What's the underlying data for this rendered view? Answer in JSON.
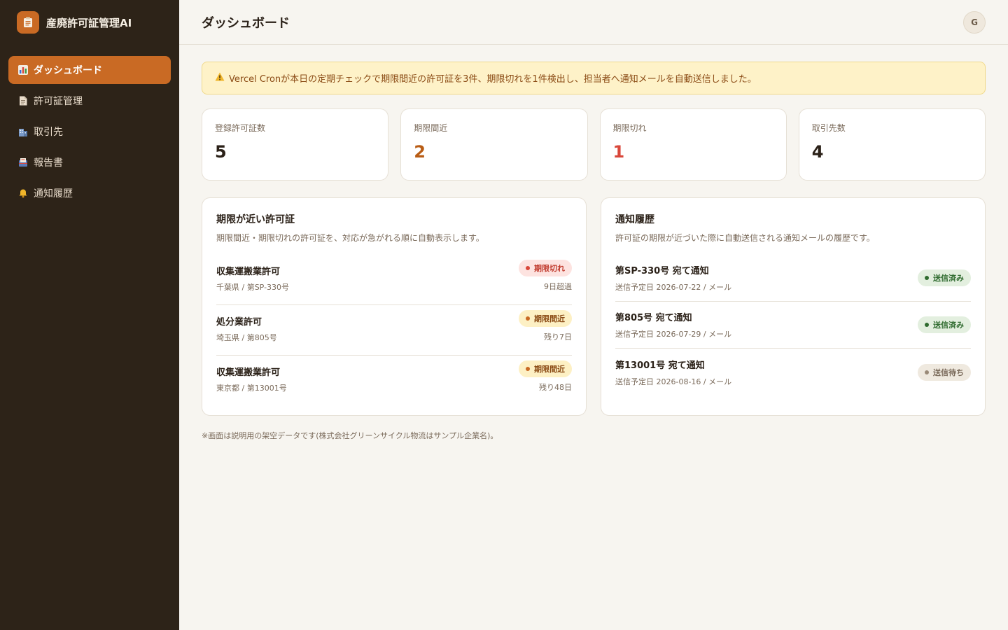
{
  "app": {
    "name": "産廃許可証管理AI"
  },
  "colors": {
    "accent": "#c96a24",
    "sidebar_bg": "#2d2318",
    "danger": "#d9473a",
    "warning": "#b85c14"
  },
  "sidebar": {
    "items": [
      {
        "label": "ダッシュボード",
        "icon": "chart-icon",
        "active": true
      },
      {
        "label": "許可証管理",
        "icon": "document-icon",
        "active": false
      },
      {
        "label": "取引先",
        "icon": "building-icon",
        "active": false
      },
      {
        "label": "報告書",
        "icon": "report-icon",
        "active": false
      },
      {
        "label": "通知履歴",
        "icon": "bell-icon",
        "active": false
      }
    ]
  },
  "header": {
    "title": "ダッシュボード",
    "avatar_initial": "G"
  },
  "alert": {
    "text": "Vercel Cronが本日の定期チェックで期限間近の許可証を3件、期限切れを1件検出し、担当者へ通知メールを自動送信しました。"
  },
  "stats": [
    {
      "label": "登録許可証数",
      "value": "5"
    },
    {
      "label": "期限間近",
      "value": "2"
    },
    {
      "label": "期限切れ",
      "value": "1"
    },
    {
      "label": "取引先数",
      "value": "4"
    }
  ],
  "permits_panel": {
    "title": "期限が近い許可証",
    "description": "期限間近・期限切れの許可証を、対応が急がれる順に自動表示します。",
    "rows": [
      {
        "title": "収集運搬業許可",
        "sub": "千葉県 / 第SP-330号",
        "badge": "期限切れ",
        "note": "9日超過"
      },
      {
        "title": "処分業許可",
        "sub": "埼玉県 / 第805号",
        "badge": "期限間近",
        "note": "残り7日"
      },
      {
        "title": "収集運搬業許可",
        "sub": "東京都 / 第13001号",
        "badge": "期限間近",
        "note": "残り48日"
      }
    ]
  },
  "notices_panel": {
    "title": "通知履歴",
    "description": "許可証の期限が近づいた際に自動送信される通知メールの履歴です。",
    "rows": [
      {
        "title": "第SP-330号 宛て通知",
        "sub": "送信予定日 2026-07-22 / メール",
        "badge": "送信済み"
      },
      {
        "title": "第805号 宛て通知",
        "sub": "送信予定日 2026-07-29 / メール",
        "badge": "送信済み"
      },
      {
        "title": "第13001号 宛て通知",
        "sub": "送信予定日 2026-08-16 / メール",
        "badge": "送信待ち"
      }
    ]
  },
  "footnote": "※画面は説明用の架空データです(株式会社グリーンサイクル物流はサンプル企業名)。"
}
